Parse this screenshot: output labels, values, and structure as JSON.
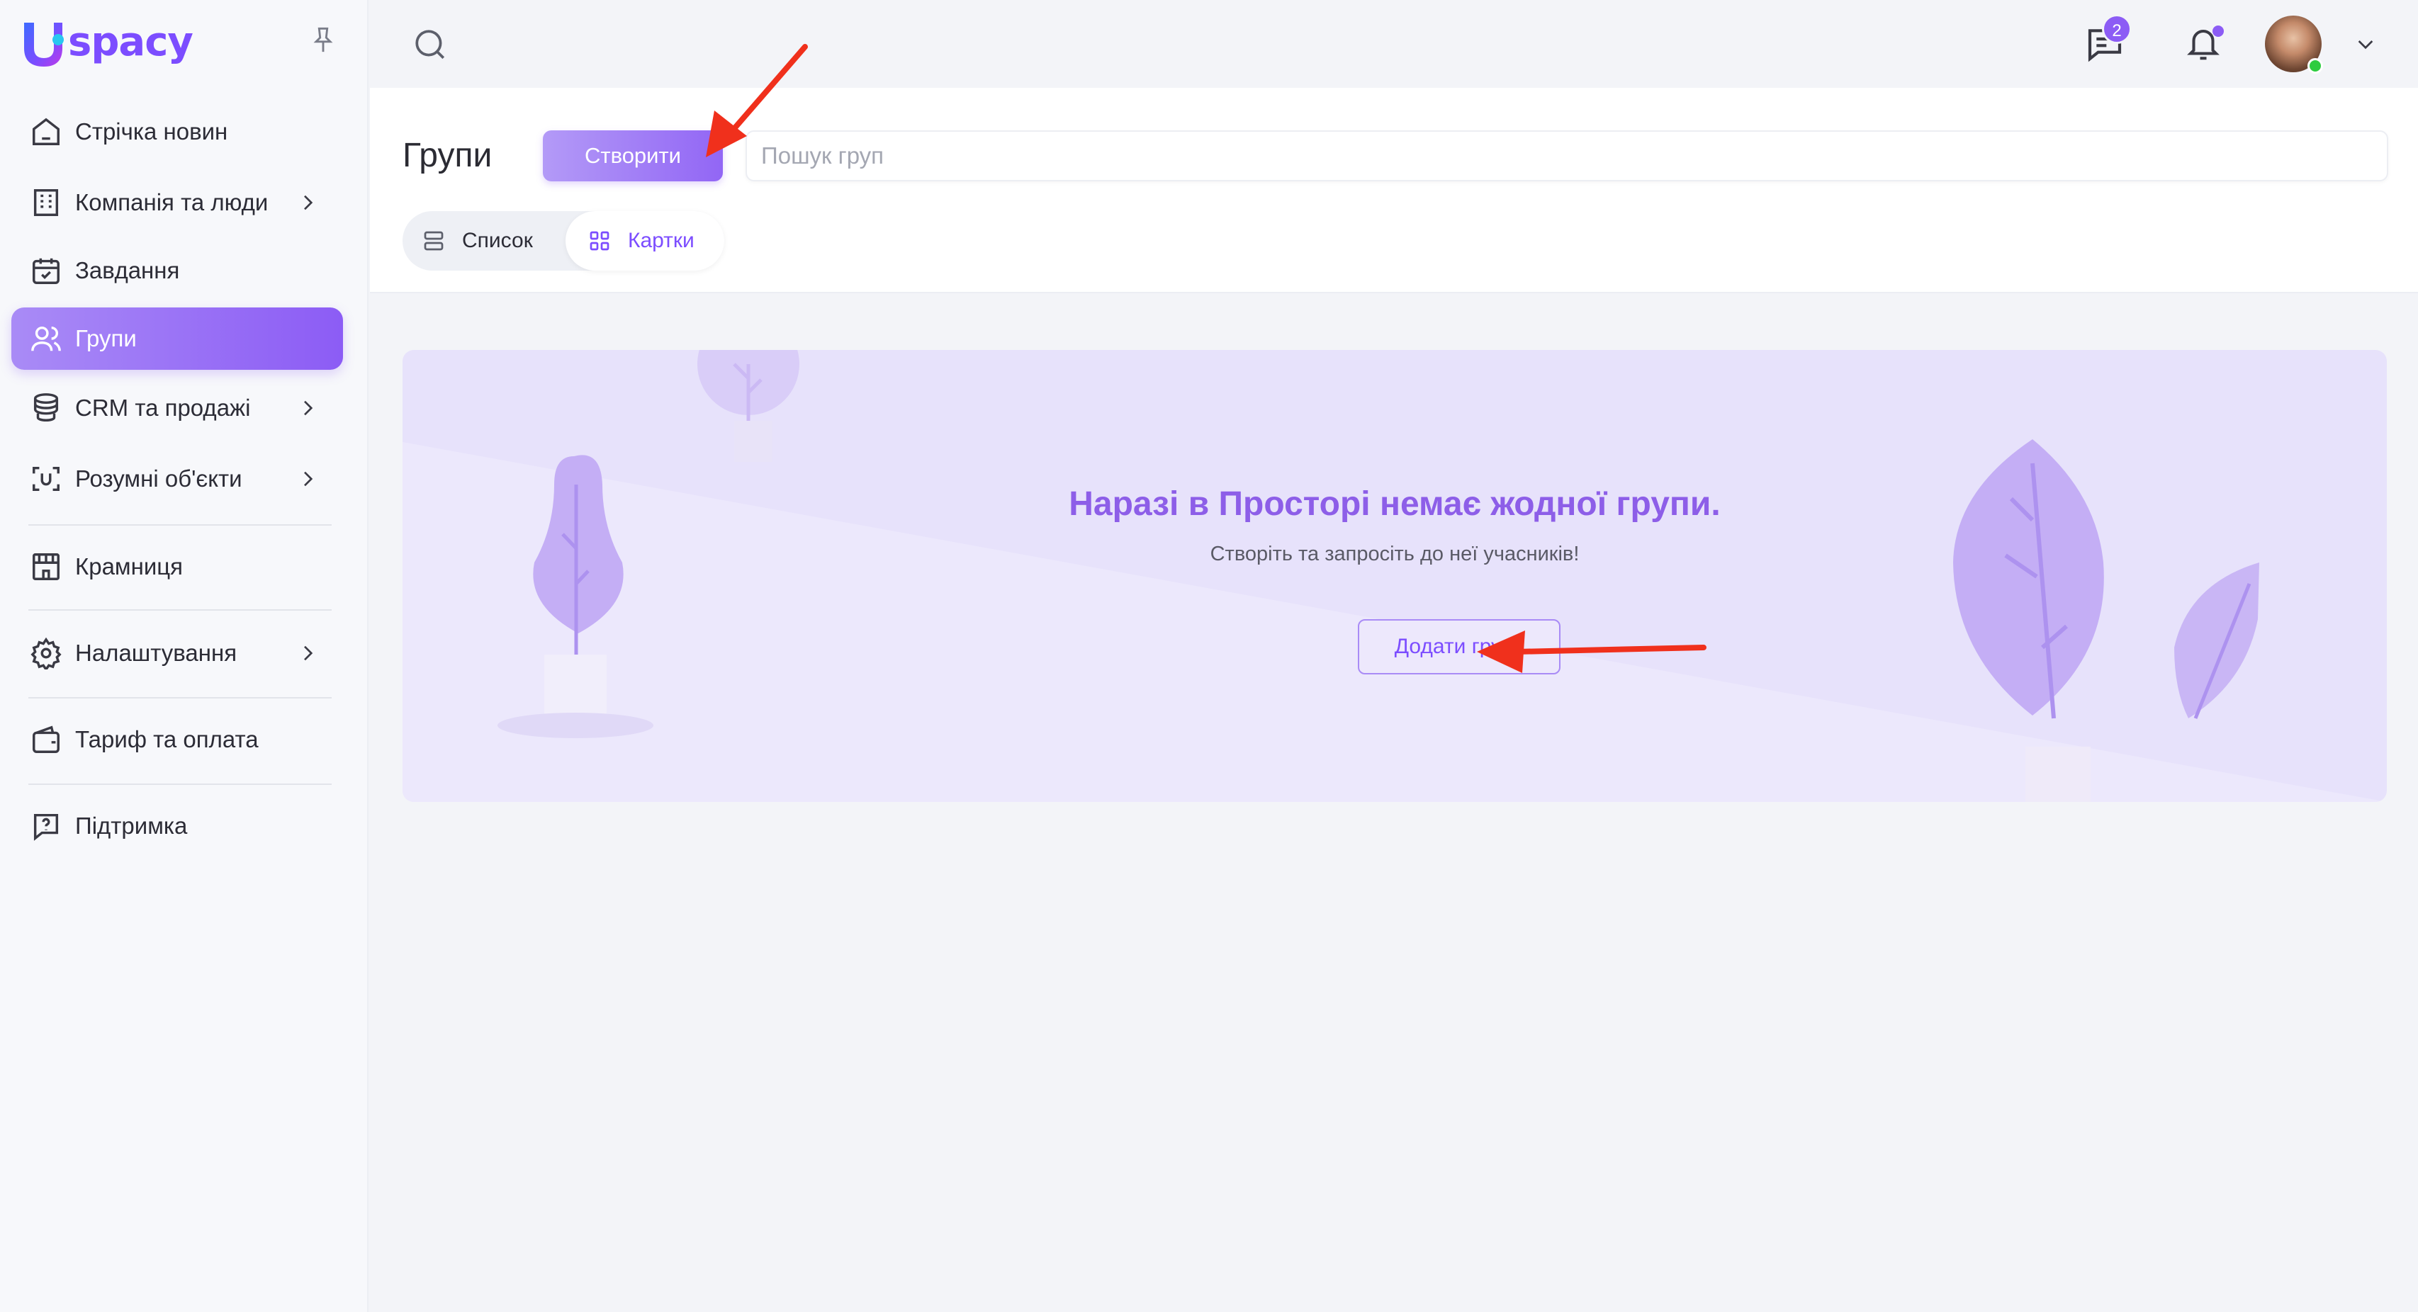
{
  "brand": {
    "logo_text": "spacy",
    "accent": "#8c5cf5"
  },
  "sidebar": {
    "items": [
      {
        "label": "Стрічка новин",
        "icon": "home-icon"
      },
      {
        "label": "Компанія та люди",
        "icon": "building-icon"
      },
      {
        "label": "Завдання",
        "icon": "calendar-check-icon"
      },
      {
        "label": "Групи",
        "icon": "users-icon"
      },
      {
        "label": "CRM та продажі",
        "icon": "coins-icon"
      },
      {
        "label": "Розумні об'єкти",
        "icon": "smart-object-icon"
      },
      {
        "label": "Крамниця",
        "icon": "store-icon"
      },
      {
        "label": "Налаштування",
        "icon": "gear-icon"
      },
      {
        "label": "Тариф та оплата",
        "icon": "wallet-icon"
      },
      {
        "label": "Підтримка",
        "icon": "help-icon"
      }
    ],
    "active_item": "Групи"
  },
  "topbar": {
    "chat_badge": "2"
  },
  "header": {
    "title": "Групи",
    "create_label": "Створити",
    "search_placeholder": "Пошук груп",
    "view_list_label": "Список",
    "view_cards_label": "Картки",
    "active_view": "Картки"
  },
  "empty_state": {
    "title": "Наразі в Просторі немає жодної групи.",
    "subtitle": "Створіть та запросіть до неї учасників!",
    "add_label": "Додати групу"
  }
}
